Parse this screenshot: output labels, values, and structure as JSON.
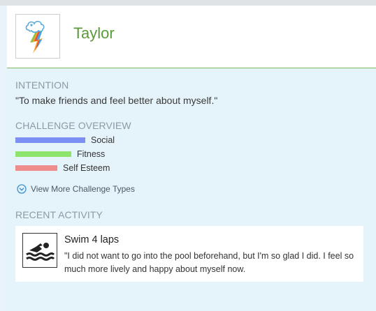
{
  "profile": {
    "name": "Taylor",
    "avatar_icon": "rainbow-cloud-icon"
  },
  "intention": {
    "title": "INTENTION",
    "text": "\"To make friends and feel better about myself.\""
  },
  "challenge_overview": {
    "title": "CHALLENGE OVERVIEW",
    "items": [
      {
        "label": "Social",
        "color": "#7b8ff5",
        "share": 1.0
      },
      {
        "label": "Fitness",
        "color": "#8de46c",
        "share": 0.8
      },
      {
        "label": "Self Esteem",
        "color": "#ef8d8d",
        "share": 0.6
      }
    ],
    "more_link": "View More Challenge Types",
    "more_icon": "chevron-down-circle-icon"
  },
  "recent_activity": {
    "title": "RECENT ACTIVITY",
    "items": [
      {
        "title": "Swim 4 laps",
        "text": "\"I did not want to go into the pool beforehand, but I'm so glad I did. I feel so much more lively and happy about myself now.",
        "icon": "swimmer-icon"
      }
    ]
  }
}
